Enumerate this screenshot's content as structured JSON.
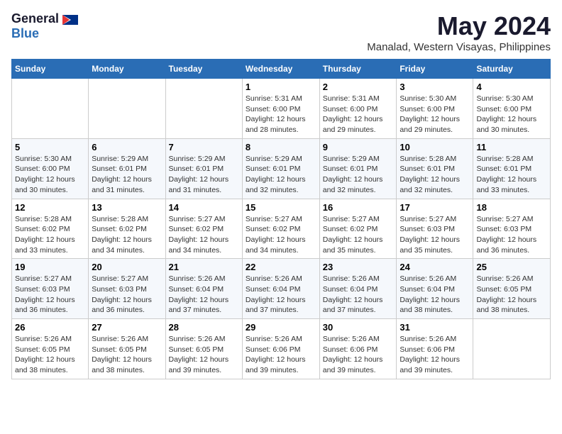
{
  "header": {
    "logo_general": "General",
    "logo_blue": "Blue",
    "month_title": "May 2024",
    "location": "Manalad, Western Visayas, Philippines"
  },
  "days_of_week": [
    "Sunday",
    "Monday",
    "Tuesday",
    "Wednesday",
    "Thursday",
    "Friday",
    "Saturday"
  ],
  "weeks": [
    [
      {
        "day": "",
        "info": ""
      },
      {
        "day": "",
        "info": ""
      },
      {
        "day": "",
        "info": ""
      },
      {
        "day": "1",
        "info": "Sunrise: 5:31 AM\nSunset: 6:00 PM\nDaylight: 12 hours and 28 minutes."
      },
      {
        "day": "2",
        "info": "Sunrise: 5:31 AM\nSunset: 6:00 PM\nDaylight: 12 hours and 29 minutes."
      },
      {
        "day": "3",
        "info": "Sunrise: 5:30 AM\nSunset: 6:00 PM\nDaylight: 12 hours and 29 minutes."
      },
      {
        "day": "4",
        "info": "Sunrise: 5:30 AM\nSunset: 6:00 PM\nDaylight: 12 hours and 30 minutes."
      }
    ],
    [
      {
        "day": "5",
        "info": "Sunrise: 5:30 AM\nSunset: 6:00 PM\nDaylight: 12 hours and 30 minutes."
      },
      {
        "day": "6",
        "info": "Sunrise: 5:29 AM\nSunset: 6:01 PM\nDaylight: 12 hours and 31 minutes."
      },
      {
        "day": "7",
        "info": "Sunrise: 5:29 AM\nSunset: 6:01 PM\nDaylight: 12 hours and 31 minutes."
      },
      {
        "day": "8",
        "info": "Sunrise: 5:29 AM\nSunset: 6:01 PM\nDaylight: 12 hours and 32 minutes."
      },
      {
        "day": "9",
        "info": "Sunrise: 5:29 AM\nSunset: 6:01 PM\nDaylight: 12 hours and 32 minutes."
      },
      {
        "day": "10",
        "info": "Sunrise: 5:28 AM\nSunset: 6:01 PM\nDaylight: 12 hours and 32 minutes."
      },
      {
        "day": "11",
        "info": "Sunrise: 5:28 AM\nSunset: 6:01 PM\nDaylight: 12 hours and 33 minutes."
      }
    ],
    [
      {
        "day": "12",
        "info": "Sunrise: 5:28 AM\nSunset: 6:02 PM\nDaylight: 12 hours and 33 minutes."
      },
      {
        "day": "13",
        "info": "Sunrise: 5:28 AM\nSunset: 6:02 PM\nDaylight: 12 hours and 34 minutes."
      },
      {
        "day": "14",
        "info": "Sunrise: 5:27 AM\nSunset: 6:02 PM\nDaylight: 12 hours and 34 minutes."
      },
      {
        "day": "15",
        "info": "Sunrise: 5:27 AM\nSunset: 6:02 PM\nDaylight: 12 hours and 34 minutes."
      },
      {
        "day": "16",
        "info": "Sunrise: 5:27 AM\nSunset: 6:02 PM\nDaylight: 12 hours and 35 minutes."
      },
      {
        "day": "17",
        "info": "Sunrise: 5:27 AM\nSunset: 6:03 PM\nDaylight: 12 hours and 35 minutes."
      },
      {
        "day": "18",
        "info": "Sunrise: 5:27 AM\nSunset: 6:03 PM\nDaylight: 12 hours and 36 minutes."
      }
    ],
    [
      {
        "day": "19",
        "info": "Sunrise: 5:27 AM\nSunset: 6:03 PM\nDaylight: 12 hours and 36 minutes."
      },
      {
        "day": "20",
        "info": "Sunrise: 5:27 AM\nSunset: 6:03 PM\nDaylight: 12 hours and 36 minutes."
      },
      {
        "day": "21",
        "info": "Sunrise: 5:26 AM\nSunset: 6:04 PM\nDaylight: 12 hours and 37 minutes."
      },
      {
        "day": "22",
        "info": "Sunrise: 5:26 AM\nSunset: 6:04 PM\nDaylight: 12 hours and 37 minutes."
      },
      {
        "day": "23",
        "info": "Sunrise: 5:26 AM\nSunset: 6:04 PM\nDaylight: 12 hours and 37 minutes."
      },
      {
        "day": "24",
        "info": "Sunrise: 5:26 AM\nSunset: 6:04 PM\nDaylight: 12 hours and 38 minutes."
      },
      {
        "day": "25",
        "info": "Sunrise: 5:26 AM\nSunset: 6:05 PM\nDaylight: 12 hours and 38 minutes."
      }
    ],
    [
      {
        "day": "26",
        "info": "Sunrise: 5:26 AM\nSunset: 6:05 PM\nDaylight: 12 hours and 38 minutes."
      },
      {
        "day": "27",
        "info": "Sunrise: 5:26 AM\nSunset: 6:05 PM\nDaylight: 12 hours and 38 minutes."
      },
      {
        "day": "28",
        "info": "Sunrise: 5:26 AM\nSunset: 6:05 PM\nDaylight: 12 hours and 39 minutes."
      },
      {
        "day": "29",
        "info": "Sunrise: 5:26 AM\nSunset: 6:06 PM\nDaylight: 12 hours and 39 minutes."
      },
      {
        "day": "30",
        "info": "Sunrise: 5:26 AM\nSunset: 6:06 PM\nDaylight: 12 hours and 39 minutes."
      },
      {
        "day": "31",
        "info": "Sunrise: 5:26 AM\nSunset: 6:06 PM\nDaylight: 12 hours and 39 minutes."
      },
      {
        "day": "",
        "info": ""
      }
    ]
  ]
}
